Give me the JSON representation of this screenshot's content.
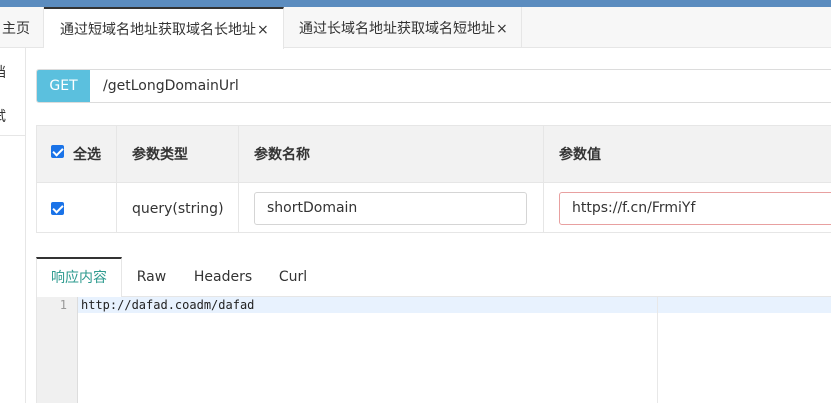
{
  "tabs": {
    "home": "主页",
    "tab1": "通过短域名地址获取域名长地址",
    "tab2": "通过长域名地址获取域名短地址",
    "close": "×"
  },
  "sidebar": {
    "item1": "档",
    "item2": "试"
  },
  "request": {
    "method": "GET",
    "path": "/getLongDomainUrl"
  },
  "params": {
    "headers": {
      "select_all": "全选",
      "type": "参数类型",
      "name": "参数名称",
      "value": "参数值"
    },
    "rows": [
      {
        "checked": true,
        "type": "query(string)",
        "name": "shortDomain",
        "value": "https://f.cn/FrmiYf"
      }
    ]
  },
  "response": {
    "tabs": [
      "响应内容",
      "Raw",
      "Headers",
      "Curl"
    ],
    "active_tab": "响应内容",
    "lines": [
      {
        "number": "1",
        "text": "http://dafad.coadm/dafad"
      }
    ]
  },
  "colors": {
    "method_badge": "#5bc0de",
    "active_tab_text": "#2e9b8f",
    "checkbox": "#1a73e8",
    "top_bar": "#5b8cbf"
  }
}
